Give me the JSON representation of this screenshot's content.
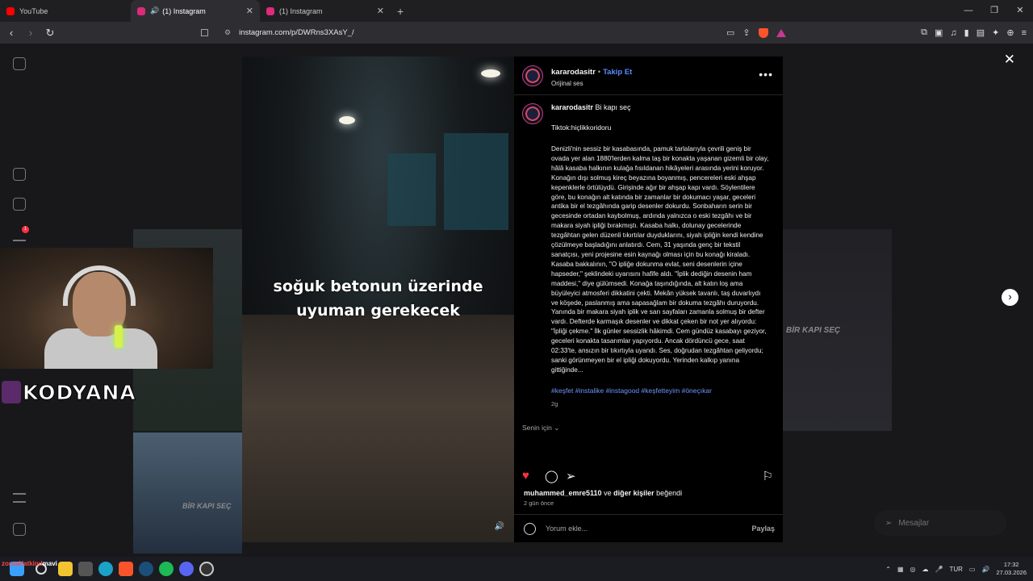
{
  "browser": {
    "tabs": [
      {
        "label": "YouTube",
        "color": "#ff0000"
      },
      {
        "label": "(1) Instagram",
        "color": "#dd2a7b",
        "active": true,
        "audio": true
      },
      {
        "label": "(1) Instagram",
        "color": "#dd2a7b"
      }
    ],
    "url": "instagram.com/p/DWRns3XAsY_/"
  },
  "reel": {
    "caption_line1": "soğuk betonun üzerinde",
    "caption_line2": "uyuman gerekecek"
  },
  "post": {
    "username": "kararodasitr",
    "follow_label": "Takip Et",
    "audio_label": "Orijinal ses",
    "title": "Bi kapı seç",
    "tiktok": "Tiktok:hiçlikkoridoru",
    "story": "Denizli'nin sessiz bir kasabasında, pamuk tarlalarıyla çevrili geniş bir ovada yer alan 1880'lerden kalma taş bir konakta yaşanan gizemli bir olay, hâlâ kasaba halkının kulağa fısıldanan hikâyeleri arasında yerini koruyor. Konağın dışı solmuş kireç beyazına boyanmış, pencereleri eski ahşap kepenklerle örtülüydü. Girişinde ağır bir ahşap kapı vardı. Söylentilere göre, bu konağın alt katında bir zamanlar bir dokumacı yaşar, geceleri antika bir el tezgâhında garip desenler dokurdu. Sonbaharın serin bir gecesinde ortadan kaybolmuş, ardında yalnızca o eski tezgâhı ve bir makara siyah ipliği bırakmıştı. Kasaba halkı, dolunay gecelerinde tezgâhtan gelen düzenli tıkırtılar duyduklarını, siyah ipliğin kendi kendine çözülmeye başladığını anlatırdı. Cem, 31 yaşında genç bir tekstil sanatçısı, yeni projesine esin kaynağı olması için bu konağı kiraladı. Kasaba bakkalının, \"O ipliğe dokunma evlat, seni desenlerin içine hapseder,\" şeklindeki uyarısını hafife aldı. \"İplik dediğin desenin ham maddesi,\" diye gülümsedi. Konağa taşındığında, alt katın loş ama büyüleyici atmosferi dikkatini çekti. Mekân yüksek tavanlı, taş duvarlıydı ve köşede, paslanmış ama sapasağlam bir dokuma tezgâhı duruyordu. Yanında bir makara siyah iplik ve sarı sayfaları zamanla solmuş bir defter vardı. Defterde karmaşık desenler ve dikkat çeken bir not yer alıyordu: \"İpliği çekme.\" İlk günler sessizlik hâkimdi. Cem gündüz kasabayı geziyor, geceleri konakta tasarımlar yapıyordu. Ancak dördüncü gece, saat 02:33'te, ansızın bir tıkırtıyla uyandı. Ses, doğrudan tezgâhtan geliyordu; sanki görünmeyen bir el ipliği dokuyordu. Yerinden kalkıp yanına gittiğinde...",
    "hashtags": "#keşfet #instalike #instagood #keşfetteyim #öneçıkar",
    "age": "2g",
    "for_you": "Senin için",
    "liked_user": "muhammed_emre5110",
    "liked_connector": " ve ",
    "liked_others": "diğer kişiler",
    "liked_suffix": " beğendi",
    "liked_ago": "2 gün önce",
    "comment_placeholder": "Yorum ekle...",
    "share_label": "Paylaş"
  },
  "overlay": {
    "streamer": "KODYANA",
    "messages_label": "Mesajlar",
    "notif_count": "1",
    "bg_label": "BİR KAPI SEÇ"
  },
  "taskbar": {
    "stream_prefix": "zoruaHatkind",
    "stream_user": "mavi",
    "lang": "TUR",
    "time": "17:32",
    "date": "27.03.2026"
  }
}
